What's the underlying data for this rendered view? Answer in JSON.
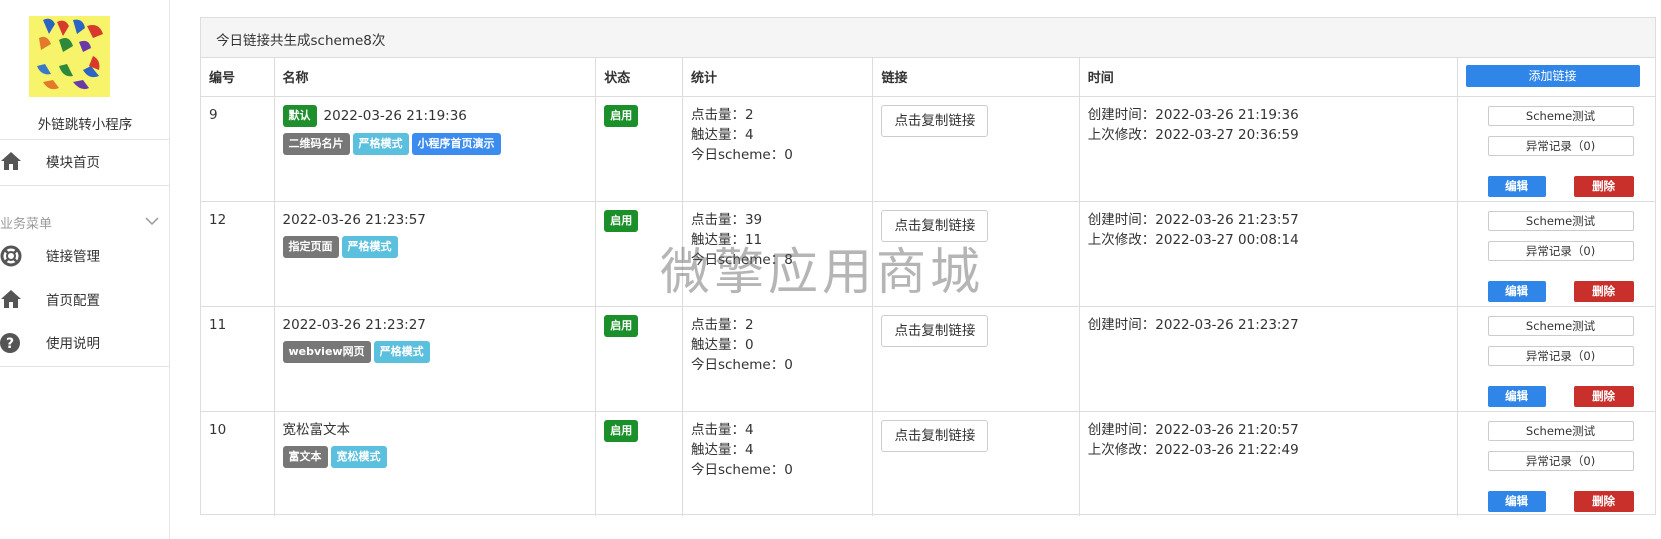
{
  "sidebar": {
    "app_name": "外链跳转小程序",
    "items": [
      {
        "label": "模块首页",
        "icon": "home-icon"
      },
      {
        "label": "链接管理",
        "icon": "lifebuoy-icon"
      },
      {
        "label": "首页配置",
        "icon": "home-icon"
      },
      {
        "label": "使用说明",
        "icon": "question-icon"
      }
    ],
    "menu_group": "业务菜单"
  },
  "panel": {
    "summary": "今日链接共生成scheme8次"
  },
  "table": {
    "headers": [
      "编号",
      "名称",
      "状态",
      "统计",
      "链接",
      "时间"
    ],
    "add_button": "添加链接",
    "rows": [
      {
        "id": "9",
        "default_tag": "默认",
        "name": "2022-03-26 21:19:36",
        "tags": [
          {
            "text": "二维码名片",
            "color": "gray"
          },
          {
            "text": "严格模式",
            "color": "cyan"
          },
          {
            "text": "小程序首页演示",
            "color": "blue"
          }
        ],
        "status": "启用",
        "stats": [
          "点击量：2",
          "触达量：4",
          "今日scheme：0"
        ],
        "copy": "点击复制链接",
        "times": [
          "创建时间：2022-03-26 21:19:36",
          "上次修改：2022-03-27 20:36:59"
        ],
        "ops": {
          "test": "Scheme测试",
          "errors": "异常记录（0)",
          "edit": "编辑",
          "delete": "删除"
        }
      },
      {
        "id": "12",
        "name": "2022-03-26 21:23:57",
        "tags": [
          {
            "text": "指定页面",
            "color": "gray"
          },
          {
            "text": "严格模式",
            "color": "cyan"
          }
        ],
        "status": "启用",
        "stats": [
          "点击量：39",
          "触达量：11",
          "今日scheme：8"
        ],
        "copy": "点击复制链接",
        "times": [
          "创建时间：2022-03-26 21:23:57",
          "上次修改：2022-03-27 00:08:14"
        ],
        "ops": {
          "test": "Scheme测试",
          "errors": "异常记录（0)",
          "edit": "编辑",
          "delete": "删除"
        }
      },
      {
        "id": "11",
        "name": "2022-03-26 21:23:27",
        "tags": [
          {
            "text": "webview网页",
            "color": "gray"
          },
          {
            "text": "严格模式",
            "color": "cyan"
          }
        ],
        "status": "启用",
        "stats": [
          "点击量：2",
          "触达量：0",
          "今日scheme：0"
        ],
        "copy": "点击复制链接",
        "times": [
          "创建时间：2022-03-26 21:23:27"
        ],
        "ops": {
          "test": "Scheme测试",
          "errors": "异常记录（0)",
          "edit": "编辑",
          "delete": "删除"
        }
      },
      {
        "id": "10",
        "name": "宽松富文本",
        "tags": [
          {
            "text": "富文本",
            "color": "gray"
          },
          {
            "text": "宽松模式",
            "color": "cyan"
          }
        ],
        "status": "启用",
        "stats": [
          "点击量：4",
          "触达量：4",
          "今日scheme：0"
        ],
        "copy": "点击复制链接",
        "times": [
          "创建时间：2022-03-26 21:20:57",
          "上次修改：2022-03-26 21:22:49"
        ],
        "ops": {
          "test": "Scheme测试",
          "errors": "异常记录（0)",
          "edit": "编辑",
          "delete": "删除"
        }
      }
    ]
  },
  "watermark": "微擎应用商城",
  "colors": {
    "primary": "#2f86e8",
    "danger": "#c9302c",
    "success": "#1a8f2a",
    "info": "#5bc0de",
    "tag_gray": "#777777"
  }
}
